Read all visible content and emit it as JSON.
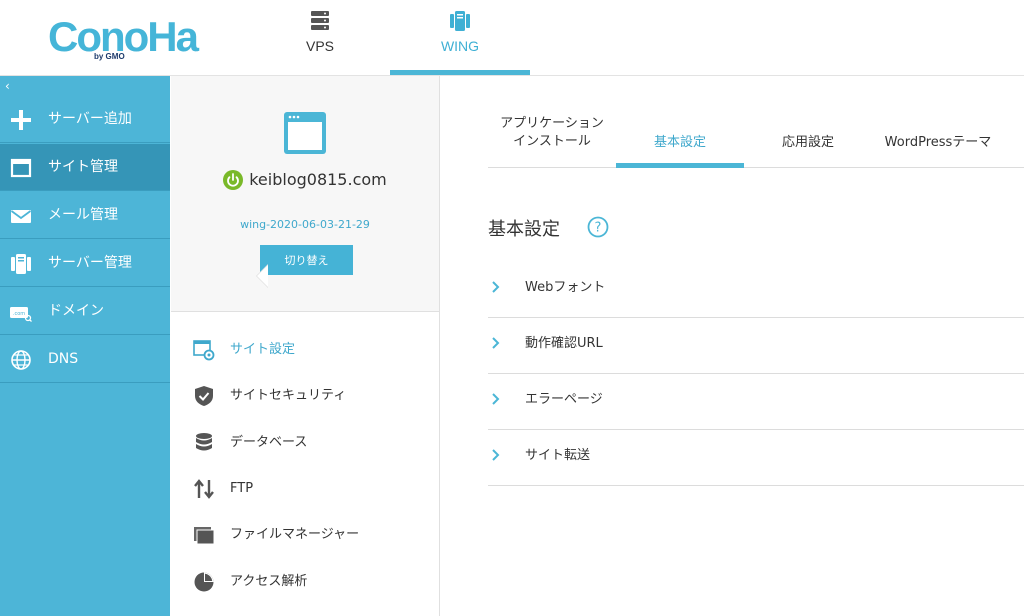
{
  "header": {
    "logo_text": "ConoHa",
    "logo_sub": "by GMO",
    "tabs": [
      {
        "label": "VPS",
        "icon": "server-rack-icon"
      },
      {
        "label": "WING",
        "icon": "wing-server-icon"
      }
    ],
    "active_tab": "WING"
  },
  "sidebar": {
    "collapse_glyph": "‹",
    "items": [
      {
        "label": "サーバー追加",
        "icon": "plus-icon"
      },
      {
        "label": "サイト管理",
        "icon": "window-icon",
        "active": true
      },
      {
        "label": "メール管理",
        "icon": "mail-icon"
      },
      {
        "label": "サーバー管理",
        "icon": "server-icon"
      },
      {
        "label": "ドメイン",
        "icon": "domain-com-icon"
      },
      {
        "label": "DNS",
        "icon": "globe-icon"
      }
    ]
  },
  "site": {
    "domain": "keiblog0815.com",
    "server_name": "wing-2020-06-03-21-29",
    "switch_label": "切り替え"
  },
  "site_menu": [
    {
      "label": "サイト設定",
      "icon": "site-settings-icon",
      "active": true
    },
    {
      "label": "サイトセキュリティ",
      "icon": "shield-check-icon"
    },
    {
      "label": "データベース",
      "icon": "database-icon"
    },
    {
      "label": "FTP",
      "icon": "transfer-arrows-icon"
    },
    {
      "label": "ファイルマネージャー",
      "icon": "folder-icon"
    },
    {
      "label": "アクセス解析",
      "icon": "pie-chart-icon"
    }
  ],
  "settings_tabs": {
    "app_install_line1": "アプリケーション",
    "app_install_line2": "インストール",
    "basic": "基本設定",
    "applied": "応用設定",
    "wordpress_theme": "WordPressテーマ",
    "active": "基本設定"
  },
  "main": {
    "section_title": "基本設定",
    "rows": [
      {
        "label": "Webフォント"
      },
      {
        "label": "動作確認URL"
      },
      {
        "label": "エラーページ"
      },
      {
        "label": "サイト転送"
      }
    ]
  },
  "colors": {
    "accent": "#4bb6d6",
    "sidebar_bg": "#4db5d7",
    "sidebar_active": "#3595b7",
    "power_green": "#7ab929"
  }
}
